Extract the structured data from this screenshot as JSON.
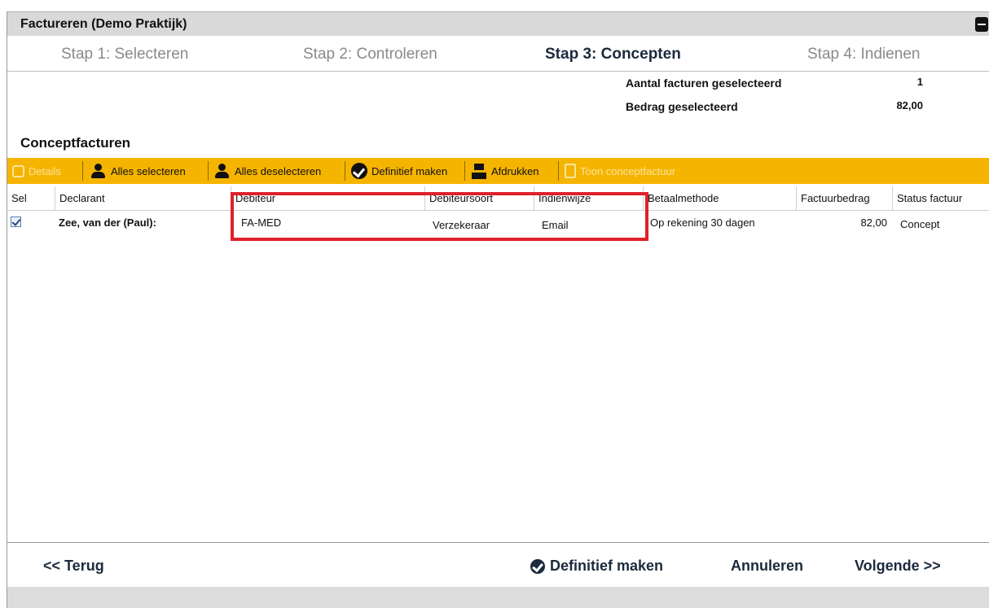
{
  "window": {
    "title": "Factureren (Demo Praktijk)"
  },
  "steps": [
    {
      "label": "Stap 1: Selecteren",
      "active": false
    },
    {
      "label": "Stap 2: Controleren",
      "active": false
    },
    {
      "label": "Stap 3: Concepten",
      "active": true
    },
    {
      "label": "Stap 4: Indienen",
      "active": false
    }
  ],
  "summary": {
    "count_label": "Aantal facturen geselecteerd",
    "count_value": "1",
    "amount_label": "Bedrag geselecteerd",
    "amount_value": "82,00"
  },
  "section": {
    "title": "Conceptfacturen"
  },
  "toolbar": {
    "details": "Details",
    "select_all": "Alles selecteren",
    "deselect_all": "Alles deselecteren",
    "finalize": "Definitief maken",
    "print": "Afdrukken",
    "show_concept": "Toon conceptfactuur"
  },
  "table": {
    "columns": [
      "Sel",
      "Declarant",
      "Debiteur",
      "Debiteursoort",
      "Indienwijze",
      "Betaalmethode",
      "Factuurbedrag",
      "Status factuur"
    ],
    "rows": [
      {
        "selected": true,
        "declarant": "Zee, van der (Paul):",
        "debiteur": "FA-MED",
        "debiteursoort": "Verzekeraar",
        "indienwijze": "Email",
        "betaalmethode": "Op rekening 30 dagen",
        "factuurbedrag": "82,00",
        "status": "Concept"
      }
    ]
  },
  "footer": {
    "back": "<< Terug",
    "finalize": "Definitief maken",
    "cancel": "Annuleren",
    "next": "Volgende >>"
  },
  "colors": {
    "toolbar": "#f5b400",
    "highlight": "#e0202a",
    "title_bar": "#d9d9d9"
  }
}
